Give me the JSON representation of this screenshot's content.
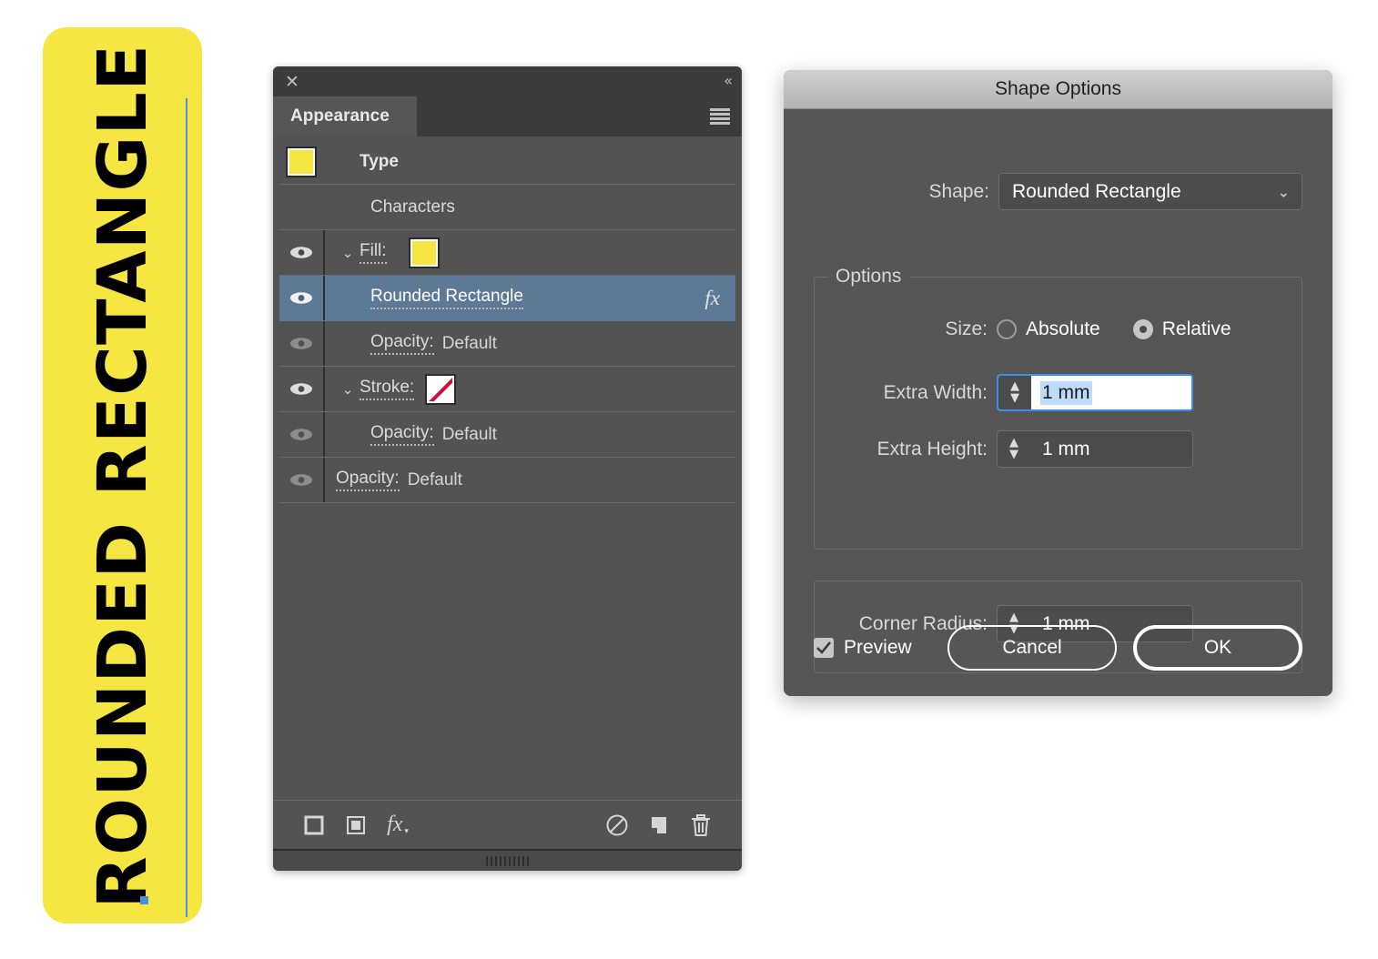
{
  "artwork": {
    "text": "ROUNDED RECTANGLE",
    "fill_color": "#F5E642",
    "text_color": "#000000",
    "guide_color": "#4A90E2"
  },
  "panel": {
    "close_icon": "close-icon",
    "collapse_icon": "«",
    "tab_label": "Appearance",
    "menu_icon": "panel-menu-icon",
    "rows": [
      {
        "label": "Type",
        "value": "",
        "kind": "object",
        "swatch": "yellow",
        "eye": "none",
        "bold": true
      },
      {
        "label": "Characters",
        "value": "",
        "kind": "characters",
        "eye": "none"
      },
      {
        "label": "Fill:",
        "value": "",
        "kind": "fill",
        "swatch": "yellow",
        "eye": "on",
        "chevron": "⌄"
      },
      {
        "label": "Rounded Rectangle",
        "value": "",
        "kind": "effect",
        "eye": "on",
        "selected": true,
        "fx": "fx"
      },
      {
        "label": "Opacity:",
        "value": "Default",
        "kind": "opacity",
        "eye": "dim"
      },
      {
        "label": "Stroke:",
        "value": "",
        "kind": "stroke",
        "swatch": "none",
        "eye": "on",
        "chevron": "⌄"
      },
      {
        "label": "Opacity:",
        "value": "Default",
        "kind": "opacity",
        "eye": "dim"
      },
      {
        "label": "Opacity:",
        "value": "Default",
        "kind": "opacity-root",
        "eye": "dim"
      }
    ],
    "footer_buttons": [
      "add-new-stroke-icon",
      "add-new-fill-icon",
      "add-new-effect-icon",
      "clear-appearance-icon",
      "duplicate-item-icon",
      "delete-item-icon"
    ]
  },
  "dialog": {
    "title": "Shape Options",
    "shape_label": "Shape:",
    "shape_value": "Rounded Rectangle",
    "options_legend": "Options",
    "size_label": "Size:",
    "size_absolute": "Absolute",
    "size_relative": "Relative",
    "size_selected": "Relative",
    "extra_width_label": "Extra Width:",
    "extra_width_value": "1 mm",
    "extra_height_label": "Extra Height:",
    "extra_height_value": "1 mm",
    "corner_radius_label": "Corner Radius:",
    "corner_radius_value": "1 mm",
    "preview_label": "Preview",
    "preview_checked": true,
    "cancel_label": "Cancel",
    "ok_label": "OK",
    "accent_focus_color": "#3B8FE8",
    "selection_color": "#BDDCFB"
  }
}
